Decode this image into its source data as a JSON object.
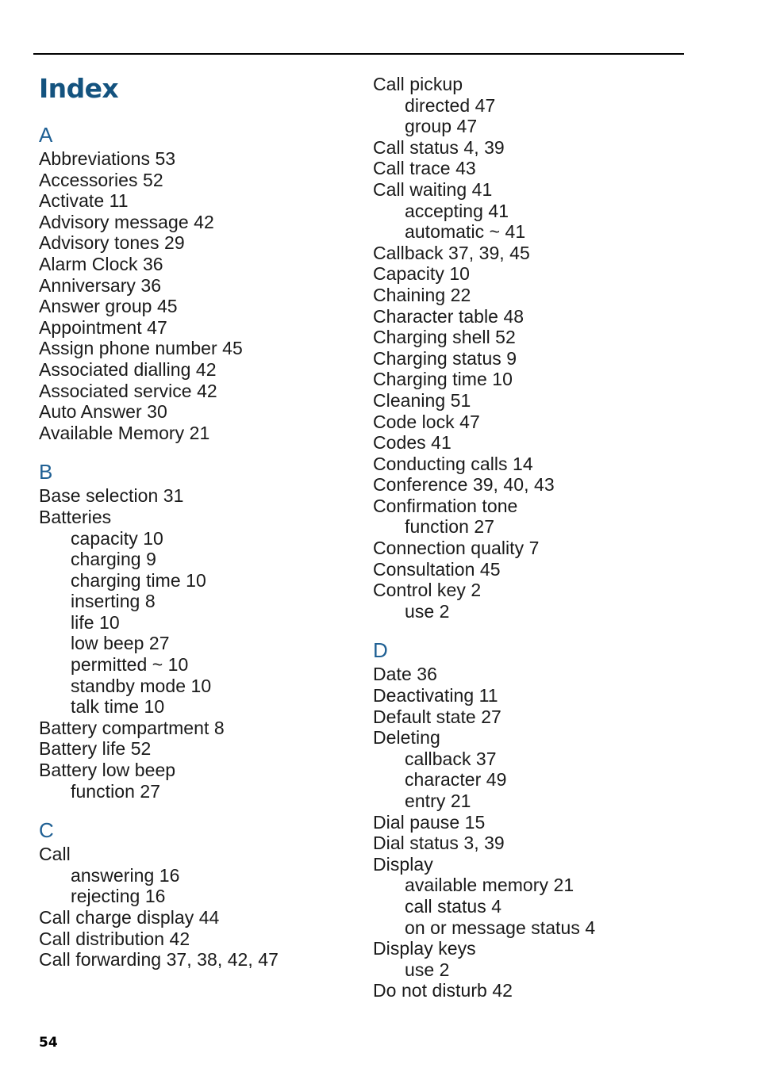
{
  "document": {
    "title": "Index",
    "page_number": "54",
    "colors": {
      "title_blue": "#14537f",
      "letter_blue": "#1f6094",
      "body_text": "#1a1a1a",
      "rule": "#000000"
    }
  },
  "columns": [
    {
      "name": "left-column",
      "sections": [
        {
          "letter": "A",
          "entries": [
            {
              "text": "Abbreviations 53",
              "level": 0
            },
            {
              "text": "Accessories 52",
              "level": 0
            },
            {
              "text": "Activate 11",
              "level": 0
            },
            {
              "text": "Advisory message 42",
              "level": 0
            },
            {
              "text": "Advisory tones 29",
              "level": 0
            },
            {
              "text": "Alarm Clock 36",
              "level": 0
            },
            {
              "text": "Anniversary 36",
              "level": 0
            },
            {
              "text": "Answer group 45",
              "level": 0
            },
            {
              "text": "Appointment 47",
              "level": 0
            },
            {
              "text": "Assign phone number 45",
              "level": 0
            },
            {
              "text": "Associated dialling 42",
              "level": 0
            },
            {
              "text": "Associated service 42",
              "level": 0
            },
            {
              "text": "Auto Answer 30",
              "level": 0
            },
            {
              "text": "Available Memory 21",
              "level": 0
            }
          ]
        },
        {
          "letter": "B",
          "entries": [
            {
              "text": "Base selection 31",
              "level": 0
            },
            {
              "text": "Batteries",
              "level": 0
            },
            {
              "text": "capacity 10",
              "level": 1
            },
            {
              "text": "charging 9",
              "level": 1
            },
            {
              "text": "charging time 10",
              "level": 1
            },
            {
              "text": "inserting 8",
              "level": 1
            },
            {
              "text": "life 10",
              "level": 1
            },
            {
              "text": "low beep 27",
              "level": 1
            },
            {
              "text": "permitted ~ 10",
              "level": 1
            },
            {
              "text": "standby mode 10",
              "level": 1
            },
            {
              "text": "talk time 10",
              "level": 1
            },
            {
              "text": "Battery compartment 8",
              "level": 0
            },
            {
              "text": "Battery life 52",
              "level": 0
            },
            {
              "text": "Battery low beep",
              "level": 0
            },
            {
              "text": "function 27",
              "level": 1
            }
          ]
        },
        {
          "letter": "C",
          "entries": [
            {
              "text": "Call",
              "level": 0
            },
            {
              "text": "answering 16",
              "level": 1
            },
            {
              "text": "rejecting 16",
              "level": 1
            },
            {
              "text": "Call charge display 44",
              "level": 0
            },
            {
              "text": "Call distribution 42",
              "level": 0
            },
            {
              "text": "Call forwarding 37, 38, 42, 47",
              "level": 0
            }
          ]
        }
      ]
    },
    {
      "name": "right-column",
      "sections": [
        {
          "letter": "",
          "entries": [
            {
              "text": "Call pickup",
              "level": 0
            },
            {
              "text": "directed 47",
              "level": 1
            },
            {
              "text": "group 47",
              "level": 1
            },
            {
              "text": "Call status 4, 39",
              "level": 0
            },
            {
              "text": "Call trace 43",
              "level": 0
            },
            {
              "text": "Call waiting 41",
              "level": 0
            },
            {
              "text": "accepting 41",
              "level": 1
            },
            {
              "text": "automatic ~ 41",
              "level": 1
            },
            {
              "text": "Callback 37, 39, 45",
              "level": 0
            },
            {
              "text": "Capacity 10",
              "level": 0
            },
            {
              "text": "Chaining 22",
              "level": 0
            },
            {
              "text": "Character table 48",
              "level": 0
            },
            {
              "text": "Charging shell 52",
              "level": 0
            },
            {
              "text": "Charging status 9",
              "level": 0
            },
            {
              "text": "Charging time 10",
              "level": 0
            },
            {
              "text": "Cleaning 51",
              "level": 0
            },
            {
              "text": "Code lock 47",
              "level": 0
            },
            {
              "text": "Codes 41",
              "level": 0
            },
            {
              "text": "Conducting calls 14",
              "level": 0
            },
            {
              "text": "Conference 39, 40, 43",
              "level": 0
            },
            {
              "text": "Confirmation tone",
              "level": 0
            },
            {
              "text": "function 27",
              "level": 1
            },
            {
              "text": "Connection quality 7",
              "level": 0
            },
            {
              "text": "Consultation 45",
              "level": 0
            },
            {
              "text": "Control key 2",
              "level": 0
            },
            {
              "text": "use 2",
              "level": 1
            }
          ]
        },
        {
          "letter": "D",
          "entries": [
            {
              "text": "Date 36",
              "level": 0
            },
            {
              "text": "Deactivating 11",
              "level": 0
            },
            {
              "text": "Default state 27",
              "level": 0
            },
            {
              "text": "Deleting",
              "level": 0
            },
            {
              "text": "callback 37",
              "level": 1
            },
            {
              "text": "character 49",
              "level": 1
            },
            {
              "text": "entry 21",
              "level": 1
            },
            {
              "text": "Dial pause 15",
              "level": 0
            },
            {
              "text": "Dial status 3, 39",
              "level": 0
            },
            {
              "text": "Display",
              "level": 0
            },
            {
              "text": "available memory 21",
              "level": 1
            },
            {
              "text": "call status 4",
              "level": 1
            },
            {
              "text": "on or message status 4",
              "level": 1
            },
            {
              "text": "Display keys",
              "level": 0
            },
            {
              "text": "use 2",
              "level": 1
            },
            {
              "text": "Do not disturb 42",
              "level": 0
            }
          ]
        }
      ]
    }
  ]
}
